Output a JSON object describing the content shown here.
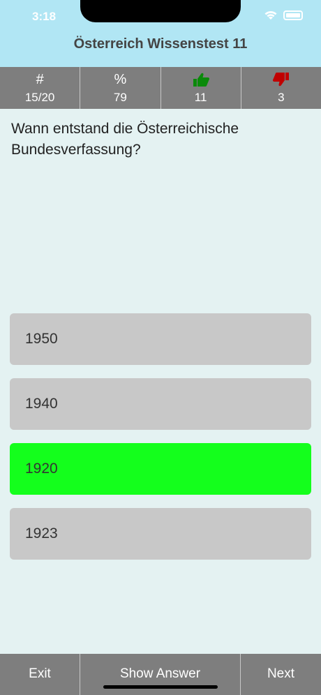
{
  "status_bar": {
    "time": "3:18"
  },
  "header": {
    "title": "Österreich Wissenstest 11"
  },
  "stats": [
    {
      "icon": "hash-icon",
      "symbol": "#",
      "value": "15/20"
    },
    {
      "icon": "percent-icon",
      "symbol": "%",
      "value": "79"
    },
    {
      "icon": "thumbs-up-icon",
      "value": "11"
    },
    {
      "icon": "thumbs-down-icon",
      "value": "3"
    }
  ],
  "question": {
    "text": "Wann entstand die Österreichische Bundesverfassung?"
  },
  "answers": [
    {
      "label": "1950",
      "state": "neutral"
    },
    {
      "label": "1940",
      "state": "neutral"
    },
    {
      "label": "1920",
      "state": "correct"
    },
    {
      "label": "1923",
      "state": "neutral"
    }
  ],
  "toolbar": {
    "exit_label": "Exit",
    "show_answer_label": "Show Answer",
    "next_label": "Next"
  },
  "colors": {
    "header_bg": "#b1e6f4",
    "bar_bg": "#7e7e7e",
    "correct": "#14ff1c",
    "thumb_up": "#0a8a0a",
    "thumb_down": "#c00000"
  }
}
